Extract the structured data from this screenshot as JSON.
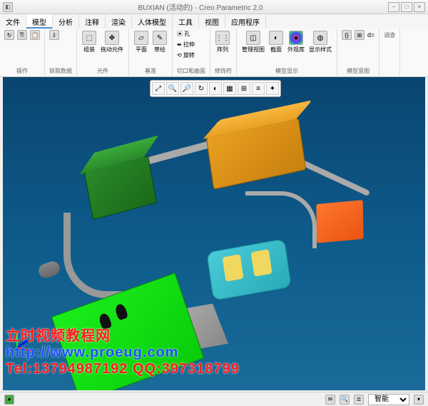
{
  "title": "BUXIAN (活动的) - Creo Parametric 2.0",
  "menus": {
    "file": "文件",
    "model": "模型",
    "analysis": "分析",
    "annotate": "注释",
    "render": "渲染",
    "manikin": "人体模型",
    "tools": "工具",
    "view": "视图",
    "apps": "应用程序"
  },
  "ribbon": {
    "ops": "操作",
    "getdata": "获取数据",
    "assemble": "组装",
    "assemble_btn": "组装",
    "drag": "拖动元件",
    "components": "元件",
    "plane": "平面",
    "sketch": "草绘",
    "datum": "基准",
    "hole": "孔",
    "stretch": "拉伸",
    "rotate": "旋转",
    "cutsurf": "切口和曲面",
    "pattern": "阵列",
    "modifiers": "修饰符",
    "manage_views": "管理视图",
    "section": "截面",
    "appearance": "外观库",
    "model_display": "模型显示",
    "display_style": "显示样式",
    "model_intent": "模型意图",
    "investigate": "调查"
  },
  "status": {
    "smart": "智能"
  },
  "watermark": {
    "l1": "立时视频教程网",
    "l2": "http://www.proeug.com",
    "l3": "Tel:13794987192  QQ:397318799"
  }
}
